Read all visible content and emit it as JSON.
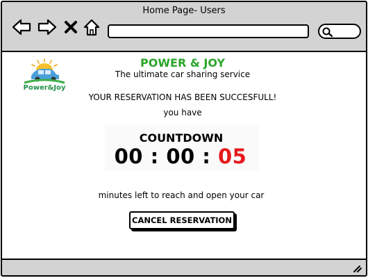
{
  "window": {
    "title": "Home Page- Users"
  },
  "toolbar": {
    "back_icon": "arrow-left-icon",
    "forward_icon": "arrow-right-icon",
    "close_icon": "close-icon",
    "home_icon": "home-icon",
    "search_icon": "search-icon"
  },
  "logo": {
    "text": "Power&Joy",
    "color": "#22924a"
  },
  "header": {
    "brand": "POWER & JOY",
    "brand_color": "#2aa52a",
    "tagline": "The ultimate car sharing service"
  },
  "message": {
    "success": "YOUR RESERVATION HAS BEEN SUCCESFULL!",
    "you_have": "you have"
  },
  "countdown": {
    "label": "COUNTDOWN",
    "hours": "00",
    "minutes": "00",
    "seconds": "05",
    "separator": ":",
    "seconds_color": "#e5191c"
  },
  "instructions": {
    "text": "minutes left to reach and open your car"
  },
  "actions": {
    "cancel_label": "CANCEL RESERVATION"
  }
}
